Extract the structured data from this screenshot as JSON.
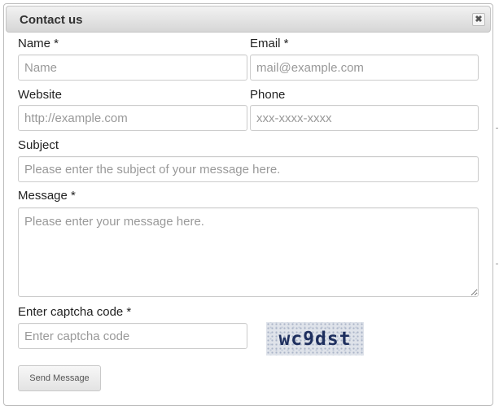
{
  "dialog": {
    "title": "Contact us",
    "close_symbol": "✖"
  },
  "form": {
    "name": {
      "label": "Name *",
      "placeholder": "Name",
      "value": ""
    },
    "email": {
      "label": "Email *",
      "placeholder": "mail@example.com",
      "value": ""
    },
    "website": {
      "label": "Website",
      "placeholder": "http://example.com",
      "value": ""
    },
    "phone": {
      "label": "Phone",
      "placeholder": "xxx-xxxx-xxxx",
      "value": ""
    },
    "subject": {
      "label": "Subject",
      "placeholder": "Please enter the subject of your message here.",
      "value": ""
    },
    "message": {
      "label": "Message *",
      "placeholder": "Please enter your message here.",
      "value": ""
    },
    "captcha": {
      "label": "Enter captcha code *",
      "placeholder": "Enter captcha code",
      "value": "",
      "image_text": "wc9dst"
    },
    "send_label": "Send Message"
  },
  "icons": {
    "close": "close-icon",
    "resize": "resize-grip-icon"
  },
  "colors": {
    "titlebar_top": "#f2f2f2",
    "titlebar_bottom": "#d6d6d6",
    "border": "#cccccc",
    "placeholder": "#999999",
    "captcha_text": "#1e2f5e"
  }
}
